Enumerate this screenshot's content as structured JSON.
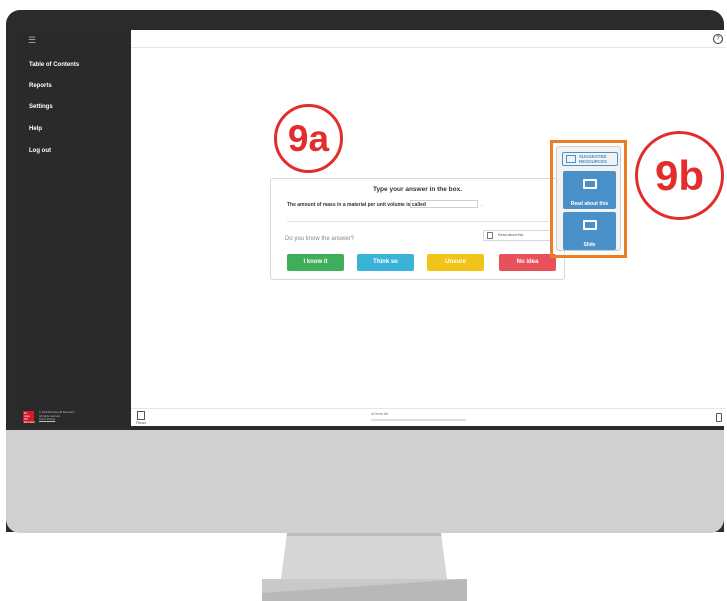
{
  "sidebar": {
    "items": [
      {
        "label": "Table of Contents"
      },
      {
        "label": "Reports"
      },
      {
        "label": "Settings"
      },
      {
        "label": "Help"
      },
      {
        "label": "Log out"
      }
    ],
    "footer": {
      "logo": "Mc Graw Hill Education",
      "copyright": "© 2016 McGraw-Hill Education",
      "rights": "All rights reserved",
      "links": "Terms   Privacy"
    }
  },
  "bottombar": {
    "read_label": "Read",
    "items_left": "## items left"
  },
  "question": {
    "title": "Type your answer in the box.",
    "prompt": "The amount of mass in a material per unit volume is called",
    "answer_value": "",
    "end_punct": ".",
    "know_label": "Do you know the answer?",
    "read_about_label": "Read about this",
    "buttons": [
      {
        "label": "I know it",
        "color": "#3fae5a"
      },
      {
        "label": "Think so",
        "color": "#3ab3d8"
      },
      {
        "label": "Unsure",
        "color": "#f2c418"
      },
      {
        "label": "No idea",
        "color": "#e8505b"
      }
    ]
  },
  "resources": {
    "heading_line1": "SUGGESTED",
    "heading_line2": "RESOURCES",
    "items": [
      {
        "label": "Read about this",
        "icon": "book-icon"
      },
      {
        "label": "Slide",
        "icon": "slide-icon"
      }
    ]
  },
  "callouts": {
    "a": "9a",
    "b": "9b"
  },
  "colors": {
    "accent_blue": "#4a90c9",
    "callout_red": "#e32d2d",
    "frame_orange": "#ed7d23"
  }
}
